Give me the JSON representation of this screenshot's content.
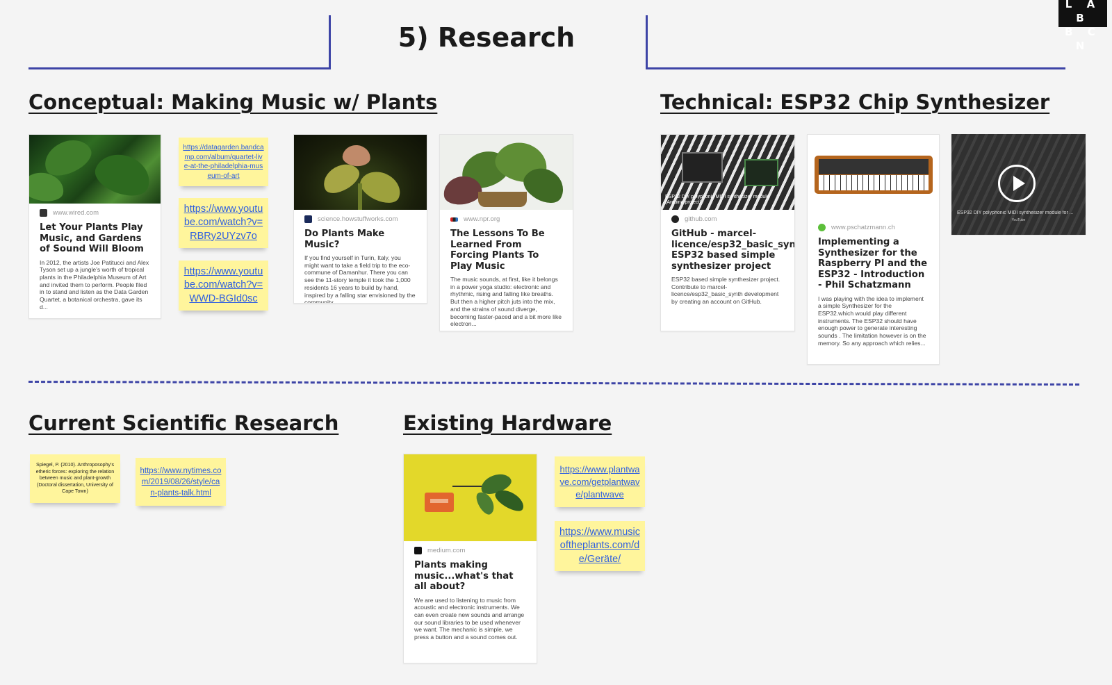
{
  "page": {
    "title": "5) Research"
  },
  "logo": {
    "line1": "L A B",
    "line2": "B C N"
  },
  "sections": {
    "conceptual": {
      "title": "Conceptual: Making Music w/ Plants",
      "cards": [
        {
          "source": "www.wired.com",
          "title": "Let Your Plants Play Music, and Gardens of Sound Will Bloom",
          "description": "In 2012, the artists Joe Patitucci and Alex Tyson set up a jungle's worth of tropical plants in the Philadelphia Museum of Art and invited them to perform. People filed in to stand and listen as the Data Garden Quartet, a botanical orchestra, gave its d..."
        },
        {
          "source": "science.howstuffworks.com",
          "title": "Do Plants Make Music?",
          "description": "If you find yourself in Turin, Italy, you might want to take a field trip to the eco-commune of Damanhur. There you can see the 11-story temple it took the 1,000 residents 16 years to build by hand, inspired by a falling star envisioned by the community..."
        },
        {
          "source": "www.npr.org",
          "title": "The Lessons To Be Learned From Forcing Plants To Play Music",
          "description": "The music sounds, at first, like it belongs in a power yoga studio: electronic and rhythmic, rising and falling like breaths. But then a higher pitch juts into the mix, and the strains of sound diverge, becoming faster-paced and a bit more like electron..."
        }
      ],
      "stickies": [
        "https://datagarden.bandcamp.com/album/quartet-live-at-the-philadelphia-museum-of-art",
        "https://www.youtube.com/watch?v=RBRy2UYzv7o",
        "https://www.youtube.com/watch?v=WWD-BGId0sc"
      ]
    },
    "technical": {
      "title": "Technical: ESP32 Chip Synthesizer",
      "cards": [
        {
          "source": "github.com",
          "title": "GitHub - marcel-licence/esp32_basic_synth: ESP32 based simple synthesizer project",
          "description": "ESP32 based simple synthesizer project. Contribute to marcel-licence/esp32_basic_synth development by creating an account on GitHub.",
          "caption": "ESP32 DIY polyphonic MIDI synthesizer module (Arduino project)"
        },
        {
          "source": "www.pschatzmann.ch",
          "title": "Implementing a Synthesizer for the Raspberry PI and the ESP32 - Introduction - Phil Schatzmann",
          "description": "I was playing with the idea to implement a simple Synthesizer for the ESP32.which would play different instruments. The ESP32 should have enough power to generate interesting sounds . The limitation however is on the memory. So any approach which relies..."
        }
      ],
      "video": {
        "caption": "ESP32 DIY polyphonic MIDI synthesizer module for ...",
        "platform": "YouTube"
      }
    },
    "scientific": {
      "title": "Current Scientific Research",
      "stickies": [
        "Spiegel, P. (2010). Anthroposophy's etheric forces: exploring the relation between music and plant-growth (Doctoral dissertation, University of Cape Town)",
        "https://www.nytimes.com/2019/08/26/style/can-plants-talk.html"
      ]
    },
    "hardware": {
      "title": "Existing Hardware",
      "card": {
        "source": "medium.com",
        "title": "Plants making music...what's that all about?",
        "description": "We are used to listening to music from acoustic and electronic instruments. We can even create new sounds and arrange our sound libraries to be used whenever we want. The mechanic is simple, we press a button and a sound comes out."
      },
      "stickies": [
        "https://www.plantwave.com/getplantwave/plantwave",
        "https://www.musicoftheplants.com/de/Geräte/"
      ]
    }
  },
  "colors": {
    "frame": "#3d44a6",
    "sticky": "#fff59c",
    "link": "#2f5fe0",
    "background": "#f4f4f4"
  }
}
